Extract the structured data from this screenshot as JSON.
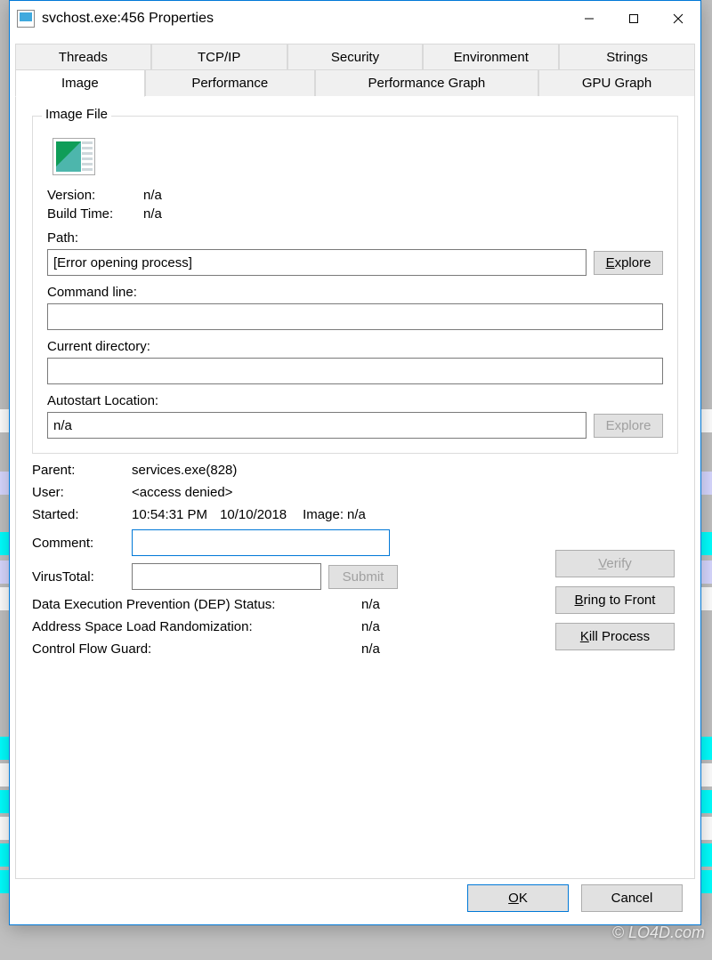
{
  "window": {
    "title": "svchost.exe:456 Properties"
  },
  "tabs": {
    "row1": [
      "Threads",
      "TCP/IP",
      "Security",
      "Environment",
      "Strings"
    ],
    "row2": [
      "Image",
      "Performance",
      "Performance Graph",
      "GPU Graph"
    ],
    "active": "Image"
  },
  "group": {
    "title": "Image File"
  },
  "image": {
    "version_label": "Version:",
    "version_value": "n/a",
    "buildtime_label": "Build Time:",
    "buildtime_value": "n/a",
    "path_label": "Path:",
    "path_value": "[Error opening process]",
    "explore_label": "Explore",
    "cmdline_label": "Command line:",
    "cmdline_value": "",
    "curdir_label": "Current directory:",
    "curdir_value": "",
    "autostart_label": "Autostart Location:",
    "autostart_value": "n/a"
  },
  "info": {
    "parent_label": "Parent:",
    "parent_value": "services.exe(828)",
    "user_label": "User:",
    "user_value": "<access denied>",
    "started_label": "Started:",
    "started_time": "10:54:31 PM",
    "started_date": "10/10/2018",
    "image_label": "Image:",
    "image_value": "n/a",
    "comment_label": "Comment:",
    "comment_value": "",
    "virustotal_label": "VirusTotal:",
    "virustotal_value": "",
    "submit_label": "Submit",
    "dep_label": "Data Execution Prevention (DEP) Status:",
    "dep_value": "n/a",
    "aslr_label": "Address Space Load Randomization:",
    "aslr_value": "n/a",
    "cfg_label": "Control Flow Guard:",
    "cfg_value": "n/a"
  },
  "side_buttons": {
    "verify": "Verify",
    "bring_to_front": "Bring to Front",
    "kill_process": "Kill Process"
  },
  "dialog_buttons": {
    "ok": "OK",
    "cancel": "Cancel"
  },
  "watermark": "© LO4D.com"
}
